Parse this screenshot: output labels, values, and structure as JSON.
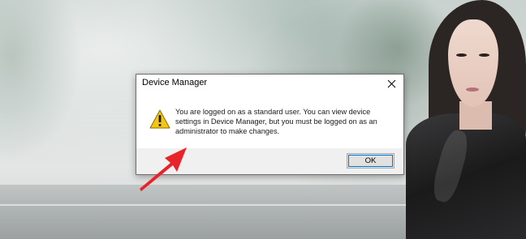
{
  "dialog": {
    "title": "Device Manager",
    "message": "You are logged on as a standard user. You can view device settings in Device Manager, but you must be logged on as an administrator to make changes.",
    "ok_label": "OK",
    "close_icon": "close-icon",
    "warning_icon": "warning-icon"
  },
  "annotation": {
    "arrow_icon": "red-arrow-icon",
    "arrow_color": "#e8242a"
  },
  "colors": {
    "focus_border": "#0078d7",
    "button_bar": "#f0f0f0",
    "warning_fill": "#f5c518"
  }
}
